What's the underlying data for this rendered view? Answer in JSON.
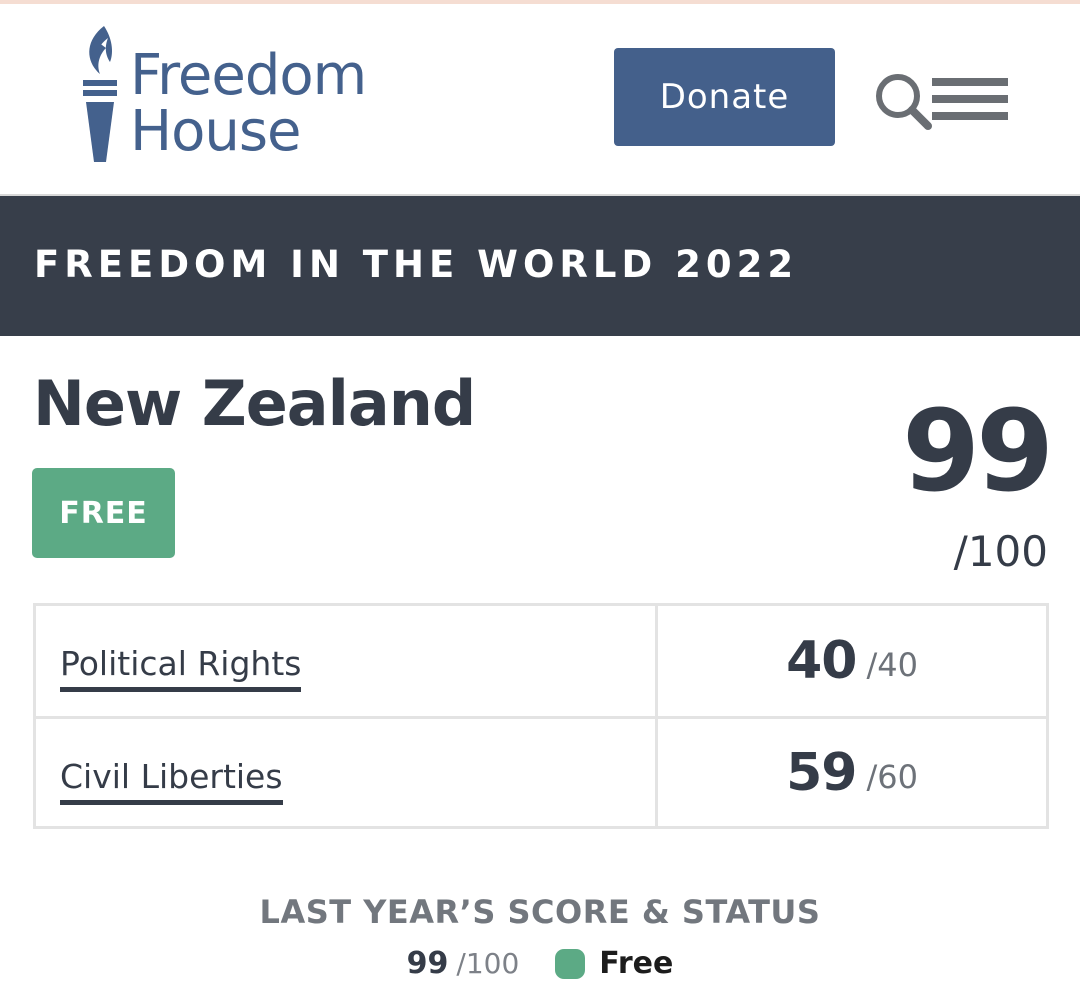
{
  "header": {
    "logo_line1": "Freedom",
    "logo_line2": "House",
    "donate_label": "Donate",
    "search_icon": "search-icon",
    "menu_icon": "hamburger-menu-icon"
  },
  "banner": {
    "title": "FREEDOM IN THE WORLD 2022"
  },
  "country": {
    "name": "New Zealand",
    "status": "FREE",
    "total_score": "99",
    "total_max": "/100"
  },
  "categories": [
    {
      "label": "Political Rights",
      "score": "40",
      "max": "/40"
    },
    {
      "label": "Civil Liberties",
      "score": "59",
      "max": "/60"
    }
  ],
  "last_year": {
    "heading": "LAST YEAR’S SCORE & STATUS",
    "score": "99",
    "max": "/100",
    "status": "Free"
  },
  "colors": {
    "brand_blue": "#44608b",
    "banner_dark": "#373e4a",
    "free_green": "#5caa85",
    "text_dark": "#353c48"
  }
}
